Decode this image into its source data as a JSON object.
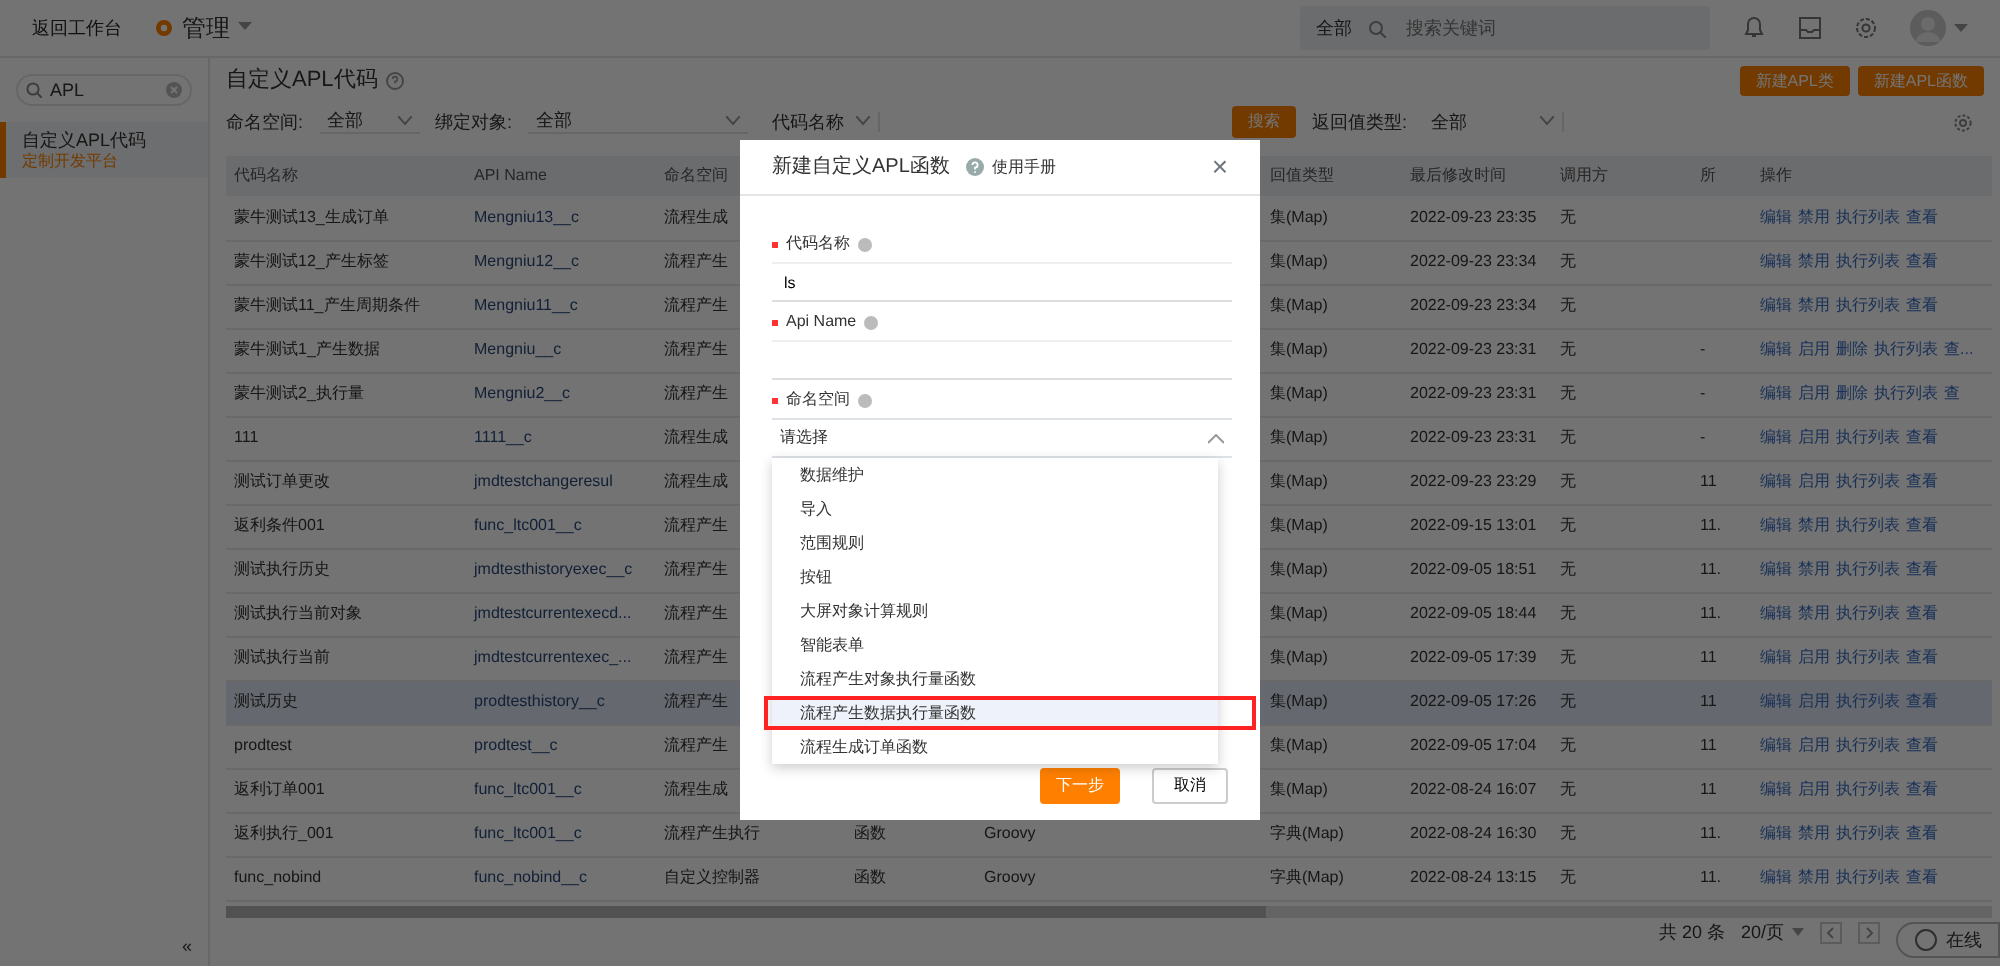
{
  "topbar": {
    "back_link": "返回工作台",
    "app_menu": "管理",
    "search_scope": "全部",
    "search_placeholder": "搜索关键词"
  },
  "sidebar": {
    "search_value": "APL",
    "items": [
      {
        "title": "自定义APL代码",
        "subtitle": "定制开发平台",
        "selected": true
      }
    ],
    "collapse": "«"
  },
  "page": {
    "title": "自定义APL代码",
    "buttons": [
      "新建APL类",
      "新建APL函数"
    ],
    "filters": [
      {
        "kind": "select",
        "label": "命名空间:",
        "value": "全部"
      },
      {
        "kind": "select",
        "label": "绑定对象:",
        "value": "全部"
      },
      {
        "kind": "combo",
        "value": "代码名称"
      },
      {
        "kind": "search",
        "button": "搜索",
        "label": "返回值类型:",
        "value": "全部"
      }
    ]
  },
  "table": {
    "columns": [
      {
        "label": "代码名称"
      },
      {
        "label": "API Name"
      },
      {
        "label": "命名空间"
      },
      {},
      {},
      {
        "label": "回值类型"
      },
      {
        "label": "最后修改时间"
      },
      {
        "label": "调用方"
      },
      {
        "label": "所"
      },
      {
        "label": "操作"
      }
    ],
    "rows": [
      {
        "cells": [
          "蒙牛测试13_生成订单",
          "Mengniu13__c",
          "流程生成",
          null,
          null,
          "集(Map)",
          "2022-09-23 23:35",
          "无",
          null
        ],
        "actions": [
          "编辑",
          "禁用",
          "执行列表",
          "查看"
        ],
        "hovered": false
      },
      {
        "cells": [
          "蒙牛测试12_产生标签",
          "Mengniu12__c",
          "流程产生",
          null,
          null,
          "集(Map)",
          "2022-09-23 23:34",
          "无",
          null
        ],
        "actions": [
          "编辑",
          "禁用",
          "执行列表",
          "查看"
        ],
        "hovered": false
      },
      {
        "cells": [
          "蒙牛测试11_产生周期条件",
          "Mengniu11__c",
          "流程产生",
          null,
          null,
          "集(Map)",
          "2022-09-23 23:34",
          "无",
          null
        ],
        "actions": [
          "编辑",
          "禁用",
          "执行列表",
          "查看"
        ],
        "hovered": false
      },
      {
        "cells": [
          "蒙牛测试1_产生数据",
          "Mengniu__c",
          "流程产生",
          null,
          null,
          "集(Map)",
          "2022-09-23 23:31",
          "无",
          "-"
        ],
        "actions": [
          "编辑",
          "启用",
          "删除",
          "执行列表",
          "查..."
        ],
        "hovered": false
      },
      {
        "cells": [
          "蒙牛测试2_执行量",
          "Mengniu2__c",
          "流程产生",
          null,
          null,
          "集(Map)",
          "2022-09-23 23:31",
          "无",
          "-"
        ],
        "actions": [
          "编辑",
          "启用",
          "删除",
          "执行列表",
          "查"
        ],
        "hovered": false
      },
      {
        "cells": [
          "111",
          "1111__c",
          "流程生成",
          null,
          null,
          "集(Map)",
          "2022-09-23 23:31",
          "无",
          "-"
        ],
        "actions": [
          "编辑",
          "启用",
          "执行列表",
          "查看"
        ],
        "hovered": false
      },
      {
        "cells": [
          "测试订单更改",
          "jmdtestchangeresul",
          "流程生成",
          null,
          null,
          "集(Map)",
          "2022-09-23 23:29",
          "无",
          "11"
        ],
        "actions": [
          "编辑",
          "启用",
          "执行列表",
          "查看"
        ],
        "hovered": false
      },
      {
        "cells": [
          "返利条件001",
          "func_ltc001__c",
          "流程产生",
          null,
          null,
          "集(Map)",
          "2022-09-15 13:01",
          "无",
          "11."
        ],
        "actions": [
          "编辑",
          "禁用",
          "执行列表",
          "查看"
        ],
        "hovered": false
      },
      {
        "cells": [
          "测试执行历史",
          "jmdtesthistoryexec__c",
          "流程产生",
          null,
          null,
          "集(Map)",
          "2022-09-05 18:51",
          "无",
          "11."
        ],
        "actions": [
          "编辑",
          "禁用",
          "执行列表",
          "查看"
        ],
        "hovered": false
      },
      {
        "cells": [
          "测试执行当前对象",
          "jmdtestcurrentexecd...",
          "流程产生",
          null,
          null,
          "集(Map)",
          "2022-09-05 18:44",
          "无",
          "11."
        ],
        "actions": [
          "编辑",
          "禁用",
          "执行列表",
          "查看"
        ],
        "hovered": false
      },
      {
        "cells": [
          "测试执行当前",
          "jmdtestcurrentexec_...",
          "流程产生",
          null,
          null,
          "集(Map)",
          "2022-09-05 17:39",
          "无",
          "11"
        ],
        "actions": [
          "编辑",
          "启用",
          "执行列表",
          "查看"
        ],
        "hovered": false
      },
      {
        "cells": [
          "测试历史",
          "prodtesthistory__c",
          "流程产生",
          null,
          null,
          "集(Map)",
          "2022-09-05 17:26",
          "无",
          "11"
        ],
        "actions": [
          "编辑",
          "启用",
          "执行列表",
          "查看"
        ],
        "hovered": true
      },
      {
        "cells": [
          "prodtest",
          "prodtest__c",
          "流程产生",
          null,
          null,
          "集(Map)",
          "2022-09-05 17:04",
          "无",
          "11"
        ],
        "actions": [
          "编辑",
          "启用",
          "执行列表",
          "查看"
        ],
        "hovered": false
      },
      {
        "cells": [
          "返利订单001",
          "func_ltc001__c",
          "流程生成",
          null,
          null,
          "集(Map)",
          "2022-08-24 16:07",
          "无",
          "11"
        ],
        "actions": [
          "编辑",
          "启用",
          "执行列表",
          "查看"
        ],
        "hovered": false
      },
      {
        "cells": [
          "返利执行_001",
          "func_ltc001__c",
          "流程产生执行",
          "函数",
          "Groovy",
          "字典(Map)",
          "2022-08-24 16:30",
          "无",
          "11."
        ],
        "actions": [
          "编辑",
          "禁用",
          "执行列表",
          "查看"
        ],
        "hovered": false
      },
      {
        "cells": [
          "func_nobind",
          "func_nobind__c",
          "自定义控制器",
          "函数",
          "Groovy",
          "字典(Map)",
          "2022-08-24 13:15",
          "无",
          "11."
        ],
        "actions": [
          "编辑",
          "禁用",
          "执行列表",
          "查看"
        ],
        "hovered": false
      }
    ]
  },
  "pagination": {
    "total": "共 20 条",
    "page_size": "20/页"
  },
  "chat_button": "在线",
  "modal": {
    "title": "新建自定义APL函数",
    "help": "使用手册",
    "close": "×",
    "fields": [
      {
        "label": "代码名称",
        "required": true,
        "value": "ls"
      },
      {
        "label": "Api Name",
        "required": true
      },
      {
        "label": "命名空间",
        "required": true,
        "placeholder": "请选择",
        "expanded": true
      }
    ],
    "dropdown": [
      {
        "label": "数据维护",
        "selected": false
      },
      {
        "label": "导入",
        "selected": false
      },
      {
        "label": "范围规则",
        "selected": false
      },
      {
        "label": "按钮",
        "selected": false
      },
      {
        "label": "大屏对象计算规则",
        "selected": false
      },
      {
        "label": "智能表单",
        "selected": false
      },
      {
        "label": "流程产生对象执行量函数",
        "selected": false
      },
      {
        "label": "流程产生数据执行量函数",
        "selected": true
      },
      {
        "label": "流程生成订单函数",
        "selected": false
      }
    ],
    "buttons": [
      {
        "label": "下一步",
        "kind": "primary"
      },
      {
        "label": "取消",
        "kind": "secondary"
      }
    ]
  }
}
